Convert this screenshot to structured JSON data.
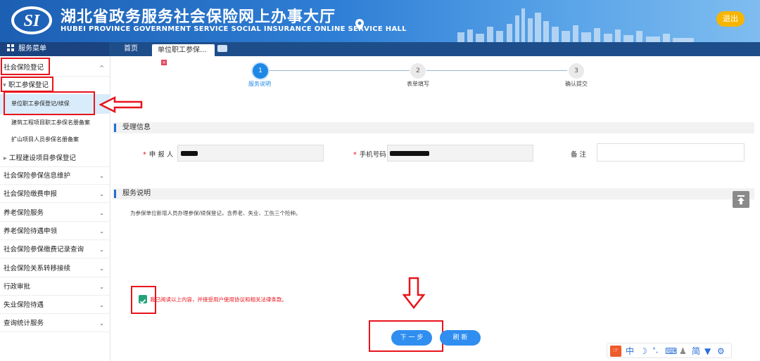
{
  "header": {
    "title": "湖北省政务服务社会保险网上办事大厅",
    "subtitle": "HUBEI PROVINCE GOVERNMENT SERVICE SOCIAL INSURANCE ONLINE SERVICE HALL",
    "exit_label": "退出"
  },
  "tabbar": {
    "menu_label": "服务菜单",
    "home_tab": "首页",
    "active_tab": "单位职工参保...",
    "close_glyph": "×"
  },
  "sidebar": {
    "items": [
      {
        "label": "社会保险登记",
        "chevron": "^"
      },
      {
        "label": "职工参保登记",
        "prefix": "▾"
      },
      {
        "label": "单位职工参保登记/续保"
      },
      {
        "label": "建筑工程项目职工参保名册备案"
      },
      {
        "label": "扩山项目人员参保名册备案"
      },
      {
        "label": "工程建设项目参保登记",
        "prefix": "▸"
      },
      {
        "label": "社会保险参保信息维护",
        "chevron": "⌄"
      },
      {
        "label": "社会保险缴费申报",
        "chevron": "⌄"
      },
      {
        "label": "养老保险服务",
        "chevron": "⌄"
      },
      {
        "label": "养老保险待遇申领",
        "chevron": "⌄"
      },
      {
        "label": "社会保险参保缴费记录查询",
        "chevron": "⌄"
      },
      {
        "label": "社会保险关系转移接续",
        "chevron": "⌄"
      },
      {
        "label": "行政审批",
        "chevron": "⌄"
      },
      {
        "label": "失业保险待遇",
        "chevron": "⌄"
      },
      {
        "label": "查询统计服务",
        "chevron": "⌄"
      }
    ]
  },
  "steps": [
    {
      "num": "1",
      "label": "服务说明",
      "state": "active"
    },
    {
      "num": "2",
      "label": "表单填写",
      "state": "inactive"
    },
    {
      "num": "3",
      "label": "确认提交",
      "state": "inactive"
    }
  ],
  "sections": {
    "accept_info": "受理信息",
    "service_desc": "服务说明"
  },
  "form": {
    "applicant_label": "申 报 人",
    "phone_label": "手机号码",
    "remark_label": "备    注",
    "required_mark": "*"
  },
  "description": "为参保单位新增人员办理参保/续保登记，含养老、失业、工伤三个险种。",
  "agreement": {
    "text": "我已阅读以上内容，并接受用户使用协议和相关法律条款。",
    "checked": true
  },
  "buttons": {
    "next": "下 一 步",
    "refresh": "刷    新"
  },
  "toolbar": {
    "items": [
      "中",
      "简"
    ]
  },
  "colors": {
    "header_blue": "#1c5fb3",
    "accent_blue": "#1e88e5",
    "highlight_red": "#e8141c",
    "exit_yellow": "#f7b500",
    "check_green": "#22a37a"
  }
}
